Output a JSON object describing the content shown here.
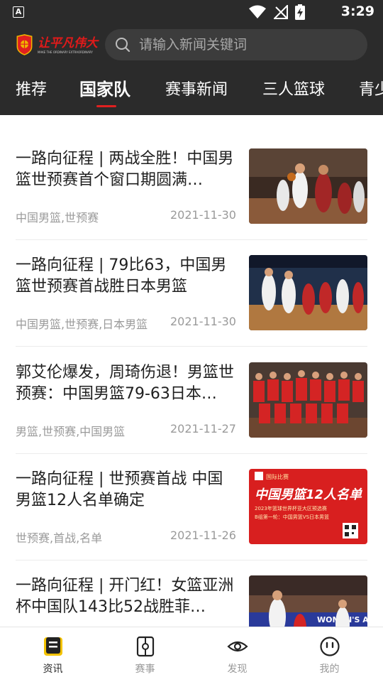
{
  "status_bar": {
    "time": "3:29",
    "a_badge": "A"
  },
  "brand": {
    "name_cn": "让平凡伟大",
    "name_en": "MAKE THE ORDINARY EXTRAORDINARY",
    "accent": "#e02020"
  },
  "search": {
    "placeholder": "请输入新闻关键词",
    "value": ""
  },
  "tabs": [
    {
      "label": "推荐",
      "active": false
    },
    {
      "label": "国家队",
      "active": true
    },
    {
      "label": "赛事新闻",
      "active": false
    },
    {
      "label": "三人篮球",
      "active": false
    },
    {
      "label": "青少",
      "active": false
    }
  ],
  "news": [
    {
      "title": "一路向征程 | 两战全胜！中国男篮世预赛首个窗口期圆满…",
      "tags": "中国男篮,世预赛",
      "date": "2021-11-30",
      "image": "basketball-game-photo"
    },
    {
      "title": "一路向征程 | 79比63，中国男篮世预赛首战胜日本男篮",
      "tags": "中国男篮,世预赛,日本男篮",
      "date": "2021-11-30",
      "image": "basketball-game-photo"
    },
    {
      "title": "郭艾伦爆发，周琦伤退！男篮世预赛：中国男篮79-63日本…",
      "tags": "男篮,世预赛,中国男篮",
      "date": "2021-11-27",
      "image": "team-photo"
    },
    {
      "title": "一路向征程 | 世预赛首战 中国男篮12人名单确定",
      "tags": "世预赛,首战,名单",
      "date": "2021-11-26",
      "image": "roster-poster",
      "poster": {
        "badge": "国际比赛",
        "headline": "中国男篮12人名单",
        "sub1": "2023年篮球世界杯亚大区预选赛",
        "sub2": "B组第一轮：中国男篮VS日本男篮"
      }
    },
    {
      "title": "一路向征程 | 开门红！女篮亚洲杯中国队143比52战胜菲…",
      "tags": "",
      "date": "",
      "image": "womens-basketball-photo",
      "banner_text": "WOMEN'S ASI"
    }
  ],
  "bottom_nav": [
    {
      "label": "资讯",
      "icon": "news-icon",
      "active": true
    },
    {
      "label": "赛事",
      "icon": "match-icon",
      "active": false
    },
    {
      "label": "发现",
      "icon": "eye-icon",
      "active": false
    },
    {
      "label": "我的",
      "icon": "profile-icon",
      "active": false
    }
  ]
}
